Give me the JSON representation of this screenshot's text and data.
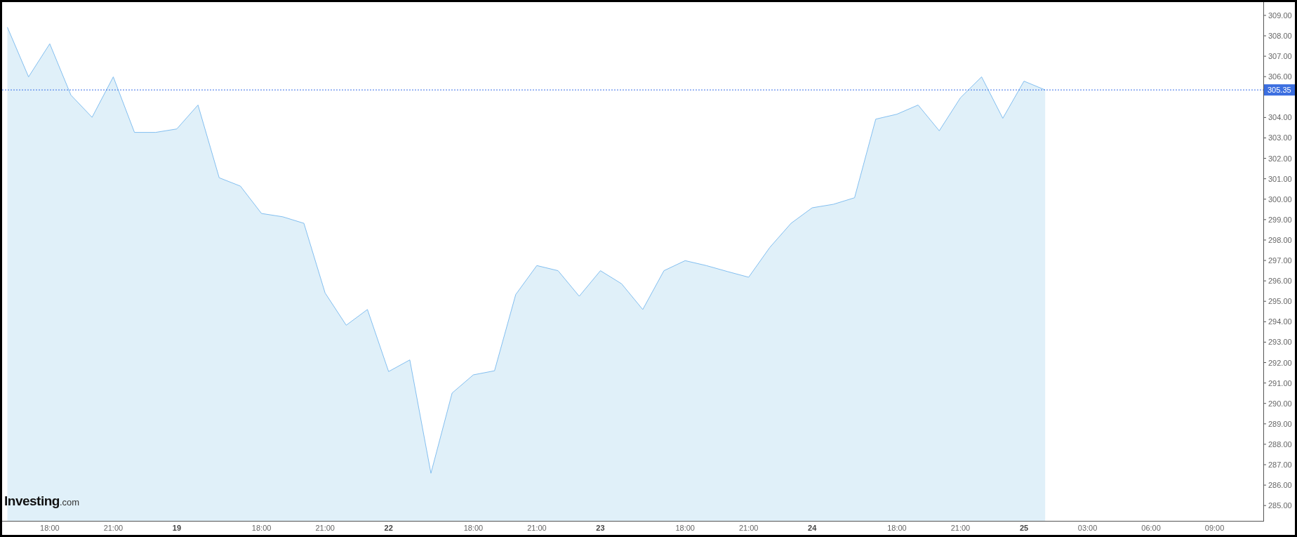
{
  "logo": {
    "name": "Investing",
    "suffix": ".com"
  },
  "chart": {
    "chart_data": {
      "type": "area",
      "categories": [
        null,
        null,
        "18:00",
        null,
        null,
        "21:00",
        null,
        null,
        "19",
        null,
        null,
        null,
        "18:00",
        null,
        null,
        "21:00",
        null,
        null,
        "22",
        null,
        null,
        null,
        "18:00",
        null,
        null,
        "21:00",
        null,
        null,
        "23",
        null,
        null,
        null,
        "18:00",
        null,
        null,
        "21:00",
        null,
        null,
        "24",
        null,
        null,
        null,
        "18:00",
        null,
        null,
        "21:00",
        null,
        null,
        "25",
        null,
        null,
        "03:00",
        null,
        null,
        "06:00",
        null,
        null,
        "09:00",
        null,
        null
      ],
      "series": [
        {
          "color": "#83bff0",
          "values": [
            308.42,
            305.99,
            307.61,
            305.1,
            304.01,
            305.99,
            303.27,
            303.27,
            303.44,
            304.61,
            301.05,
            300.64,
            299.3,
            299.14,
            298.82,
            295.41,
            293.83,
            294.6,
            291.56,
            292.13,
            286.58,
            290.51,
            291.4,
            291.6,
            295.33,
            296.75,
            296.5,
            295.25,
            296.5,
            295.86,
            294.6,
            296.5,
            296.99,
            296.75,
            296.46,
            296.18,
            297.64,
            298.82,
            299.58,
            299.75,
            300.07,
            303.92,
            304.16,
            304.61,
            303.35,
            304.97,
            305.99,
            303.96,
            305.78,
            305.35,
            null,
            null,
            null,
            null,
            null,
            null,
            null,
            null,
            null,
            null
          ]
        }
      ],
      "ylim": [
        284.25,
        309.65
      ],
      "ref_lines": [
        {
          "axis": "y",
          "value": 305.35,
          "label": "305.35"
        }
      ],
      "yticks": [
        {
          "value": 285,
          "label": "285.00"
        },
        {
          "value": 286,
          "label": "286.00"
        },
        {
          "value": 287,
          "label": "287.00"
        },
        {
          "value": 288,
          "label": "288.00"
        },
        {
          "value": 289,
          "label": "289.00"
        },
        {
          "value": 290,
          "label": "290.00"
        },
        {
          "value": 291,
          "label": "291.00"
        },
        {
          "value": 292,
          "label": "292.00"
        },
        {
          "value": 293,
          "label": "293.00"
        },
        {
          "value": 294,
          "label": "294.00"
        },
        {
          "value": 295,
          "label": "295.00"
        },
        {
          "value": 296,
          "label": "296.00"
        },
        {
          "value": 297,
          "label": "297.00"
        },
        {
          "value": 298,
          "label": "298.00"
        },
        {
          "value": 299,
          "label": "299.00"
        },
        {
          "value": 300,
          "label": "300.00"
        },
        {
          "value": 301,
          "label": "301.00"
        },
        {
          "value": 302,
          "label": "302.00"
        },
        {
          "value": 303,
          "label": "303.00"
        },
        {
          "value": 304,
          "label": "304.00"
        },
        {
          "value": 306,
          "label": "306.00"
        },
        {
          "value": 307,
          "label": "307.00"
        },
        {
          "value": 308,
          "label": "308.00"
        },
        {
          "value": 309,
          "label": "309.00"
        }
      ]
    }
  }
}
